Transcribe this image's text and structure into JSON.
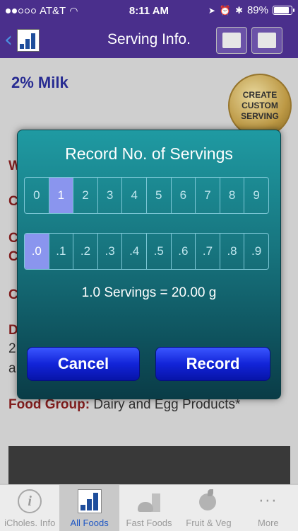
{
  "status_bar": {
    "carrier": "AT&T",
    "signal_bars_filled": 2,
    "time": "8:11 AM",
    "battery": "89%",
    "battery_level": 0.89
  },
  "nav": {
    "title": "Serving Info.",
    "back_icon": "chevron-left-icon",
    "left_icon": "bar-chart-icon",
    "right_icons": [
      "edit-icon",
      "print-icon"
    ]
  },
  "background": {
    "food_title": "2% Milk",
    "custom_serving_line1": "CREATE",
    "custom_serving_line2": "CUSTOM",
    "custom_serving_line3": "SERVING",
    "partial_labels": [
      "W",
      "C",
      "C",
      "C",
      "C",
      "D"
    ],
    "partial_lines": [
      "2",
      "a"
    ],
    "food_group_label": "Food Group:",
    "food_group_value": "Dairy and Egg Products*"
  },
  "dialog": {
    "title": "Record No. of Servings",
    "whole_digits": [
      "0",
      "1",
      "2",
      "3",
      "4",
      "5",
      "6",
      "7",
      "8",
      "9"
    ],
    "whole_selected": 1,
    "decimal_digits": [
      ".0",
      ".1",
      ".2",
      ".3",
      ".4",
      ".5",
      ".6",
      ".7",
      ".8",
      ".9"
    ],
    "decimal_selected": 0,
    "summary": "1.0 Servings = 20.00 g",
    "cancel_label": "Cancel",
    "record_label": "Record"
  },
  "tabs": [
    {
      "label": "iCholes. Info",
      "icon": "info-icon",
      "active": false
    },
    {
      "label": "All Foods",
      "icon": "bar-chart-icon",
      "active": true
    },
    {
      "label": "Fast Foods",
      "icon": "fast-food-icon",
      "active": false
    },
    {
      "label": "Fruit & Veg",
      "icon": "fruit-veg-icon",
      "active": false
    },
    {
      "label": "More",
      "icon": "more-icon",
      "active": false
    }
  ],
  "colors": {
    "nav_bg": "#4a2f8c",
    "food_title": "#2b2f9c",
    "dialog_teal": "#17747e",
    "selected_digit": "#8a95ee",
    "button_blue": "#1224d8",
    "active_tab_label": "#1f57c4"
  }
}
